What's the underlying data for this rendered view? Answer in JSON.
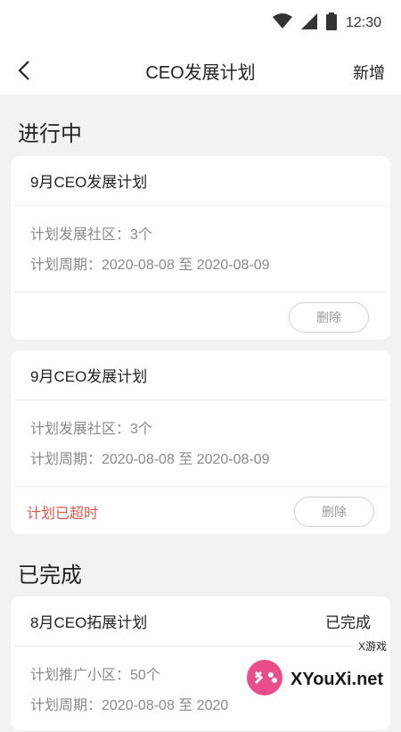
{
  "status_bar": {
    "time": "12:30"
  },
  "nav": {
    "title": "CEO发展计划",
    "action_label": "新增"
  },
  "sections": {
    "in_progress": "进行中",
    "completed": "已完成"
  },
  "cards": [
    {
      "title": "9月CEO发展计划",
      "line1": "计划发展社区：3个",
      "line2": "计划周期：2020-08-08 至 2020-08-09",
      "delete_label": "删除",
      "overdue_text": ""
    },
    {
      "title": "9月CEO发展计划",
      "line1": "计划发展社区：3个",
      "line2": "计划周期：2020-08-08 至 2020-08-09",
      "delete_label": "删除",
      "overdue_text": "计划已超时"
    },
    {
      "title": "8月CEO拓展计划",
      "status": "已完成",
      "line1": "计划推广小区：50个",
      "line2": "计划周期：2020-08-08 至 2020"
    }
  ],
  "watermark": {
    "text": "XYouXi.net",
    "small": "X游戏"
  },
  "colors": {
    "overdue": "#e0564b",
    "background": "#f2f2f2"
  }
}
